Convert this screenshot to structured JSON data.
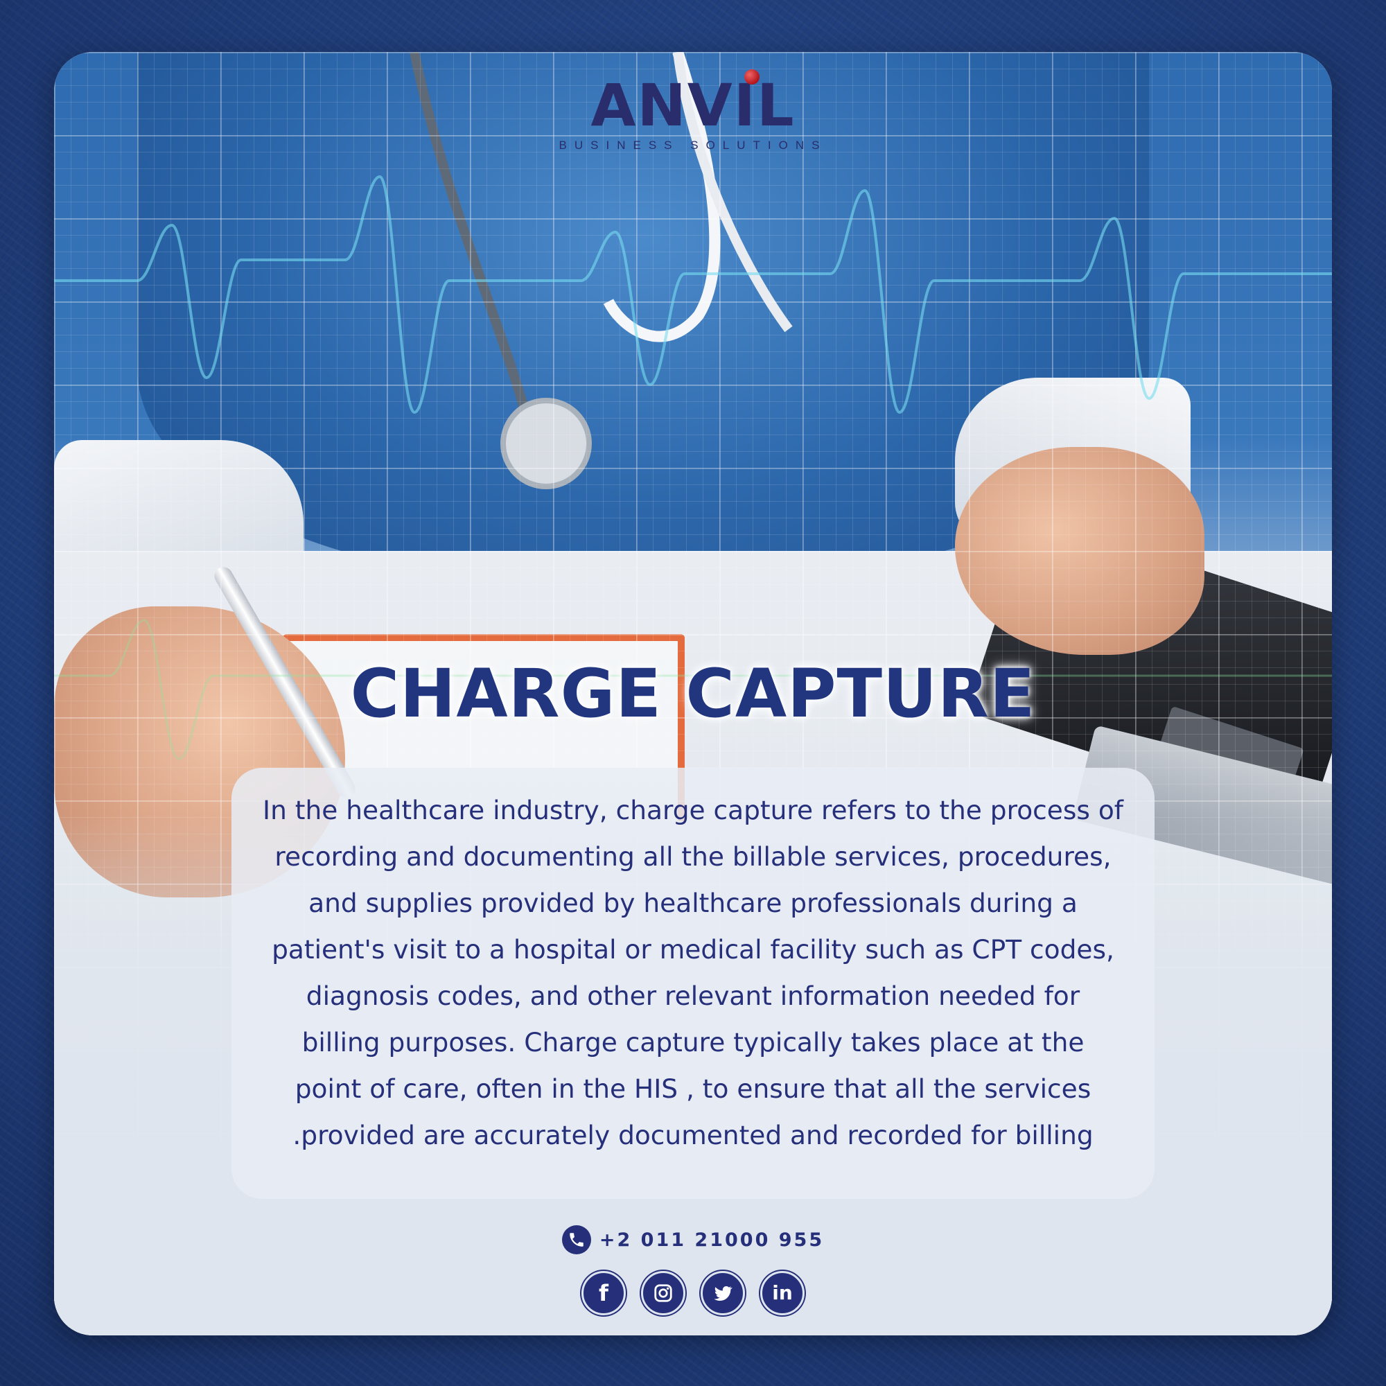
{
  "brand": {
    "name": "ANVIL",
    "tagline": "BUSINESS SOLUTIONS"
  },
  "headline": "CHARGE CAPTURE",
  "body_lines": [
    "In the healthcare industry, charge capture refers to the process of",
    "recording and documenting all the billable services, procedures,",
    "and supplies provided by healthcare professionals during a",
    "patient's visit to a hospital or medical facility such as CPT codes,",
    "diagnosis codes, and other relevant information needed for",
    "billing purposes. Charge capture typically takes place at the",
    "point of care, often in the HIS , to ensure that all the services",
    ".provided are accurately documented and recorded for billing"
  ],
  "contact": {
    "phone": "+2 011 21000 955"
  },
  "social": [
    {
      "icon": "facebook-icon"
    },
    {
      "icon": "instagram-icon"
    },
    {
      "icon": "twitter-icon"
    },
    {
      "icon": "linkedin-icon"
    }
  ],
  "colors": {
    "primary_navy": "#26307a",
    "logo_navy": "#2a2d6b",
    "logo_dot_red": "#b3141b",
    "frame_blue": "#1f3c78",
    "panel_bg": "#e8ecf4"
  }
}
